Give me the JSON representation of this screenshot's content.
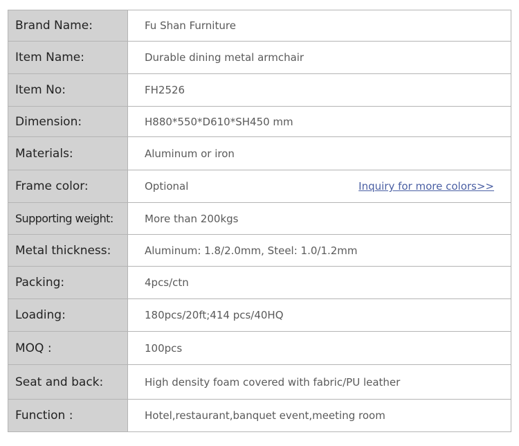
{
  "specs": {
    "rows": [
      {
        "label": "Brand Name:",
        "value": "Fu Shan Furniture"
      },
      {
        "label": "Item Name:",
        "value": "Durable dining metal armchair"
      },
      {
        "label": "Item No:",
        "value": "FH2526"
      },
      {
        "label": "Dimension:",
        "value": "H880*550*D610*SH450 mm"
      },
      {
        "label": "Materials:",
        "value": "Aluminum or iron"
      },
      {
        "label": "Frame color:",
        "value": "Optional",
        "link": "Inquiry for more colors>>"
      },
      {
        "label": "Supporting weight:",
        "value": "More than 200kgs"
      },
      {
        "label": "Metal thickness:",
        "value": "Aluminum: 1.8/2.0mm, Steel: 1.0/1.2mm"
      },
      {
        "label": "Packing:",
        "value": "4pcs/ctn"
      },
      {
        "label": "Loading:",
        "value": "180pcs/20ft;414 pcs/40HQ"
      },
      {
        "label": "MOQ :",
        "value": "100pcs"
      },
      {
        "label": "Seat and back:",
        "value": "High density foam covered with fabric/PU leather"
      },
      {
        "label": "Function :",
        "value": "Hotel,restaurant,banquet event,meeting room"
      }
    ]
  }
}
